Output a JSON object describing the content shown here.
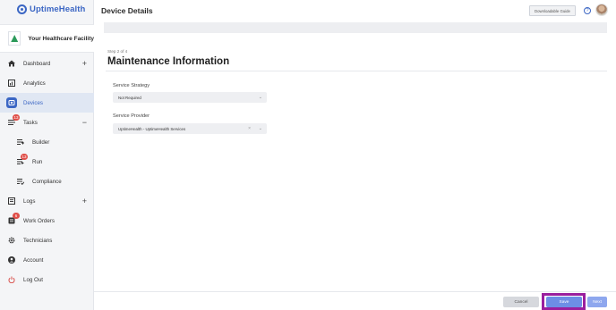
{
  "brand": {
    "name": "UptimeHealth",
    "icon": "uptimehealth-logo-icon",
    "color": "#3b66c4"
  },
  "facility": {
    "name": "Your Healthcare Facility"
  },
  "sidebar": {
    "items": [
      {
        "label": "Dashboard",
        "icon": "home-icon",
        "action": "+"
      },
      {
        "label": "Analytics",
        "icon": "chart-icon"
      },
      {
        "label": "Devices",
        "icon": "device-icon",
        "active": true
      },
      {
        "label": "Tasks",
        "icon": "tasks-icon",
        "badge": "13",
        "action": "−"
      },
      {
        "label": "Builder",
        "icon": "builder-icon"
      },
      {
        "label": "Run",
        "icon": "run-icon",
        "badge": "13"
      },
      {
        "label": "Compliance",
        "icon": "compliance-icon"
      },
      {
        "label": "Logs",
        "icon": "logs-icon",
        "action": "+"
      },
      {
        "label": "Work Orders",
        "icon": "work-orders-icon",
        "badge": "6"
      },
      {
        "label": "Technicians",
        "icon": "gear-icon"
      },
      {
        "label": "Account",
        "icon": "user-icon"
      },
      {
        "label": "Log Out",
        "icon": "power-icon"
      }
    ]
  },
  "header": {
    "title": "Device Details",
    "guide_button": "Downloadable Guide",
    "help_icon": "?"
  },
  "main": {
    "step": "Step 2 of 4",
    "title": "Maintenance Information",
    "fields": [
      {
        "label": "Service Strategy",
        "value": "Not Required"
      },
      {
        "label": "Service Provider",
        "value": "UptimeHealth - UptimeHealth Services",
        "clear": "×"
      }
    ]
  },
  "footer": {
    "cancel_label": "Cancel",
    "save_label": "Save",
    "next_label": "Next"
  },
  "colors": {
    "accent": "#3b66c4",
    "save_button": "#6d8ee6",
    "highlight": "#9a1f9e",
    "badge": "#e0504a"
  }
}
